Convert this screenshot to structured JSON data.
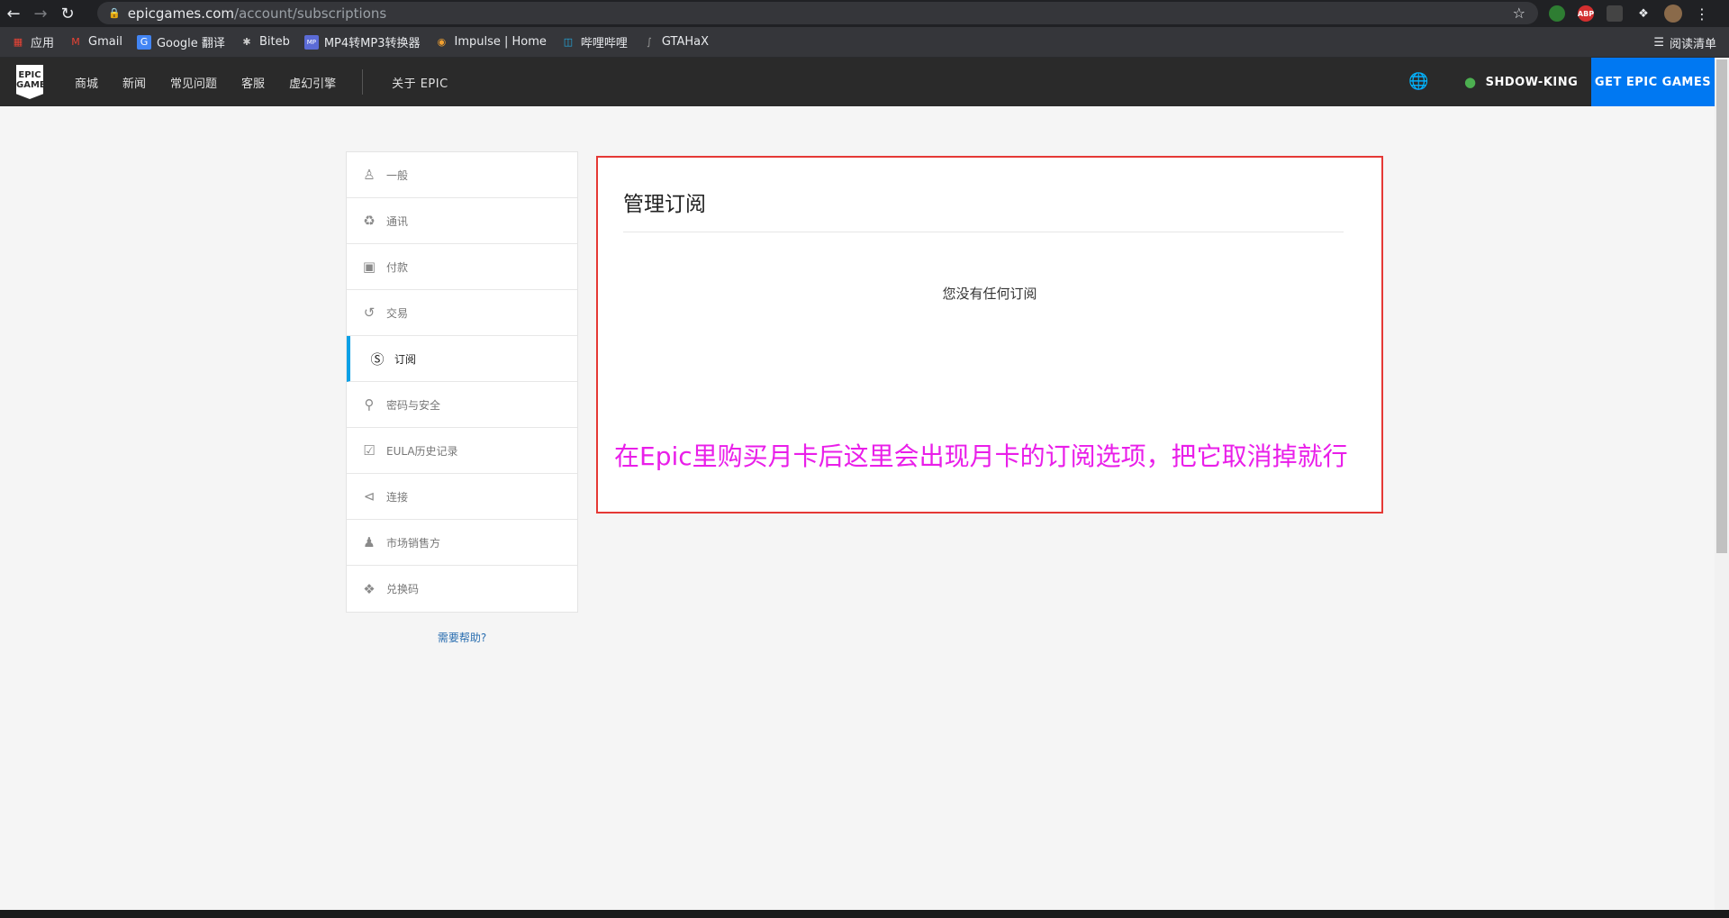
{
  "browser": {
    "url_host": "epicgames.com",
    "url_path": "/account/subscriptions",
    "back_icon": "arrow-left-icon",
    "bookmarks": [
      {
        "label": "应用",
        "icon": "apps-grid-icon",
        "color": "#ea4335"
      },
      {
        "label": "Gmail",
        "icon": "gmail-icon",
        "color": "#ea4335"
      },
      {
        "label": "Google 翻译",
        "icon": "translate-icon",
        "color": "#4285f4"
      },
      {
        "label": "Biteb",
        "icon": "biteb-icon",
        "color": "#777777"
      },
      {
        "label": "MP4转MP3转换器",
        "icon": "mp4-icon",
        "color": "#5b6bd6"
      },
      {
        "label": "Impulse | Home",
        "icon": "impulse-icon",
        "color": "#f0a030"
      },
      {
        "label": "哔哩哔哩",
        "icon": "bilibili-icon",
        "color": "#23ade5"
      },
      {
        "label": "GTAHaX",
        "icon": "gtahax-icon",
        "color": "#999999"
      }
    ],
    "reading_list": "阅读清单"
  },
  "epic_nav": {
    "links": [
      "商城",
      "新闻",
      "常见问题",
      "客服",
      "虚幻引擎"
    ],
    "about": "关于 EPIC",
    "username": "SHDOW-KING",
    "get_button": "GET EPIC GAMES",
    "logo_text": "EPIC GAMES"
  },
  "sidebar": {
    "items": [
      {
        "label": "一般",
        "icon": "person-icon",
        "glyph": "☺"
      },
      {
        "label": "通讯",
        "icon": "bell-icon",
        "glyph": "♪"
      },
      {
        "label": "付款",
        "icon": "wallet-icon",
        "glyph": "▣"
      },
      {
        "label": "交易",
        "icon": "history-icon",
        "glyph": "↺"
      },
      {
        "label": "订阅",
        "icon": "subscription-icon",
        "glyph": "Ⓢ",
        "active": true
      },
      {
        "label": "密码与安全",
        "icon": "key-icon",
        "glyph": "⚒"
      },
      {
        "label": "EULA历史记录",
        "icon": "clipboard-check-icon",
        "glyph": "☑"
      },
      {
        "label": "连接",
        "icon": "share-icon",
        "glyph": "⭡"
      },
      {
        "label": "市场销售方",
        "icon": "seller-icon",
        "glyph": "♟"
      },
      {
        "label": "兑换码",
        "icon": "gift-icon",
        "glyph": "❖"
      }
    ],
    "help": "需要帮助?"
  },
  "main": {
    "title": "管理订阅",
    "empty_message": "您没有任何订阅",
    "annotation": "在Epic里购买月卡后这里会出现月卡的订阅选项，把它取消掉就行"
  },
  "colors": {
    "active_accent": "#0aa0e6",
    "get_button": "#0078f2",
    "annotation": "#e91ee9",
    "highlight_box": "#e53935"
  }
}
